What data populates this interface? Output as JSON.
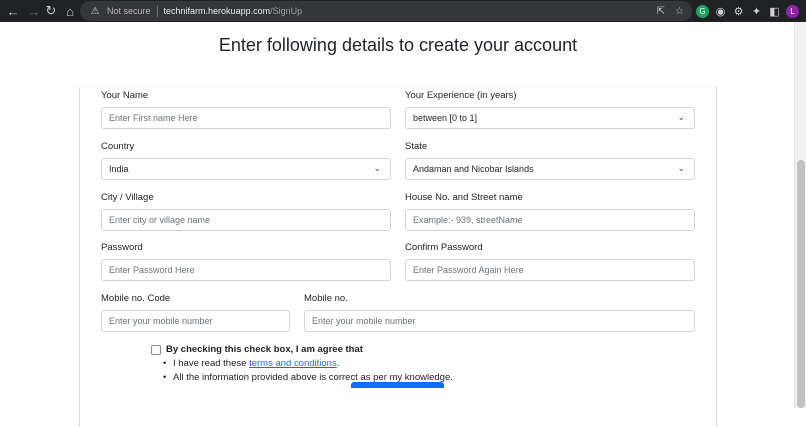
{
  "browser": {
    "not_secure": "Not secure",
    "url_host": "technifarm.herokuapp.com",
    "url_path": "/SignUp",
    "avatar_letter": "L"
  },
  "page": {
    "title": "Enter following details to create your account"
  },
  "form": {
    "name": {
      "label": "Your Name",
      "placeholder": "Enter First name Here"
    },
    "experience": {
      "label": "Your Experience (in years)",
      "value": "between [0 to 1]"
    },
    "country": {
      "label": "Country",
      "value": "India"
    },
    "state": {
      "label": "State",
      "value": "Andaman and Nicobar Islands"
    },
    "city": {
      "label": "City / Village",
      "placeholder": "Enter city or village name"
    },
    "street": {
      "label": "House No. and Street name",
      "placeholder": "Example:- 939, streetName"
    },
    "password": {
      "label": "Password",
      "placeholder": "Enter Password Here"
    },
    "confirm_password": {
      "label": "Confirm Password",
      "placeholder": "Enter Password Again Here"
    },
    "mobile_code": {
      "label": "Mobile no. Code",
      "placeholder": "Enter your mobile number"
    },
    "mobile": {
      "label": "Mobile no.",
      "placeholder": "Enter your mobile number"
    },
    "agree": {
      "title": "By checking this check box, I am agree that",
      "bullet1_prefix": "I have read these ",
      "bullet1_link": "terms and conditions",
      "bullet1_suffix": ".",
      "bullet2": "All the information provided above is correct as per my knowledge."
    }
  },
  "colors": {
    "accent": "#0d6efd",
    "chrome_bg": "#202124"
  }
}
